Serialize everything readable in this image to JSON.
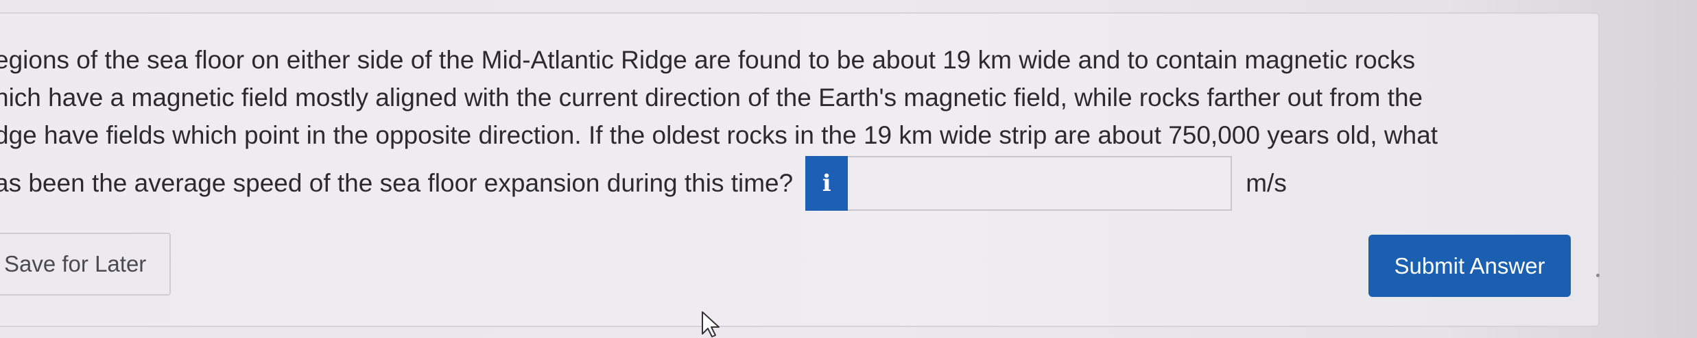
{
  "question": {
    "lines": [
      "egions of the sea floor on either side of the Mid-Atlantic Ridge are found to be about 19 km wide and to contain magnetic rocks",
      "hich have a magnetic field mostly aligned with the current direction of the Earth's magnetic field, while rocks farther out from the",
      "dge have fields which point in the opposite direction. If the oldest rocks in the 19 km wide strip are about 750,000 years old, what"
    ],
    "prompt": "as been the average speed of the sea floor expansion during this time?"
  },
  "answer": {
    "info_icon": "info-icon",
    "info_glyph": "i",
    "value": "",
    "placeholder": "",
    "units": "m/s"
  },
  "actions": {
    "save_label": "Save for Later",
    "submit_label": "Submit Answer"
  },
  "colors": {
    "accent": "#1b5fb0",
    "text": "#2b2b2e",
    "background": "#eceaee"
  }
}
